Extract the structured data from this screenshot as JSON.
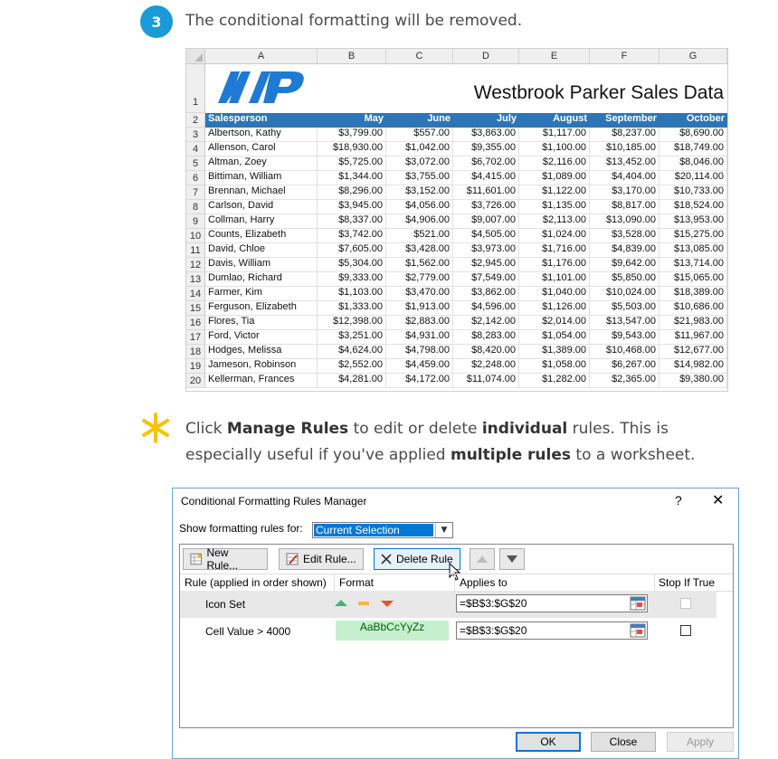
{
  "step": {
    "number": "3",
    "text": "The conditional formatting will be removed."
  },
  "sheet": {
    "columns": [
      "A",
      "B",
      "C",
      "D",
      "E",
      "F",
      "G"
    ],
    "title": "Westbrook Parker Sales Data",
    "logo_text": "WP",
    "header_row_number": "2",
    "title_row_number": "1",
    "headers": [
      "Salesperson",
      "May",
      "June",
      "July",
      "August",
      "September",
      "October"
    ],
    "rows": [
      {
        "n": "3",
        "cells": [
          "Albertson, Kathy",
          "$3,799.00",
          "$557.00",
          "$3,863.00",
          "$1,117.00",
          "$8,237.00",
          "$8,690.00"
        ]
      },
      {
        "n": "4",
        "cells": [
          "Allenson, Carol",
          "$18,930.00",
          "$1,042.00",
          "$9,355.00",
          "$1,100.00",
          "$10,185.00",
          "$18,749.00"
        ]
      },
      {
        "n": "5",
        "cells": [
          "Altman, Zoey",
          "$5,725.00",
          "$3,072.00",
          "$6,702.00",
          "$2,116.00",
          "$13,452.00",
          "$8,046.00"
        ]
      },
      {
        "n": "6",
        "cells": [
          "Bittiman, William",
          "$1,344.00",
          "$3,755.00",
          "$4,415.00",
          "$1,089.00",
          "$4,404.00",
          "$20,114.00"
        ]
      },
      {
        "n": "7",
        "cells": [
          "Brennan, Michael",
          "$8,296.00",
          "$3,152.00",
          "$11,601.00",
          "$1,122.00",
          "$3,170.00",
          "$10,733.00"
        ]
      },
      {
        "n": "8",
        "cells": [
          "Carlson, David",
          "$3,945.00",
          "$4,056.00",
          "$3,726.00",
          "$1,135.00",
          "$8,817.00",
          "$18,524.00"
        ]
      },
      {
        "n": "9",
        "cells": [
          "Collman, Harry",
          "$8,337.00",
          "$4,906.00",
          "$9,007.00",
          "$2,113.00",
          "$13,090.00",
          "$13,953.00"
        ]
      },
      {
        "n": "10",
        "cells": [
          "Counts, Elizabeth",
          "$3,742.00",
          "$521.00",
          "$4,505.00",
          "$1,024.00",
          "$3,528.00",
          "$15,275.00"
        ]
      },
      {
        "n": "11",
        "cells": [
          "David, Chloe",
          "$7,605.00",
          "$3,428.00",
          "$3,973.00",
          "$1,716.00",
          "$4,839.00",
          "$13,085.00"
        ]
      },
      {
        "n": "12",
        "cells": [
          "Davis, William",
          "$5,304.00",
          "$1,562.00",
          "$2,945.00",
          "$1,176.00",
          "$9,642.00",
          "$13,714.00"
        ]
      },
      {
        "n": "13",
        "cells": [
          "Dumlao, Richard",
          "$9,333.00",
          "$2,779.00",
          "$7,549.00",
          "$1,101.00",
          "$5,850.00",
          "$15,065.00"
        ]
      },
      {
        "n": "14",
        "cells": [
          "Farmer, Kim",
          "$1,103.00",
          "$3,470.00",
          "$3,862.00",
          "$1,040.00",
          "$10,024.00",
          "$18,389.00"
        ]
      },
      {
        "n": "15",
        "cells": [
          "Ferguson, Elizabeth",
          "$1,333.00",
          "$1,913.00",
          "$4,596.00",
          "$1,126.00",
          "$5,503.00",
          "$10,686.00"
        ]
      },
      {
        "n": "16",
        "cells": [
          "Flores, Tia",
          "$12,398.00",
          "$2,883.00",
          "$2,142.00",
          "$2,014.00",
          "$13,547.00",
          "$21,983.00"
        ]
      },
      {
        "n": "17",
        "cells": [
          "Ford, Victor",
          "$3,251.00",
          "$4,931.00",
          "$8,283.00",
          "$1,054.00",
          "$9,543.00",
          "$11,967.00"
        ]
      },
      {
        "n": "18",
        "cells": [
          "Hodges, Melissa",
          "$4,624.00",
          "$4,798.00",
          "$8,420.00",
          "$1,389.00",
          "$10,468.00",
          "$12,677.00"
        ]
      },
      {
        "n": "19",
        "cells": [
          "Jameson, Robinson",
          "$2,552.00",
          "$4,459.00",
          "$2,248.00",
          "$1,058.00",
          "$6,267.00",
          "$14,982.00"
        ]
      },
      {
        "n": "20",
        "cells": [
          "Kellerman, Frances",
          "$4,281.00",
          "$4,172.00",
          "$11,074.00",
          "$1,282.00",
          "$2,365.00",
          "$9,380.00"
        ]
      }
    ]
  },
  "tip": {
    "p1": "Click ",
    "b1": "Manage Rules",
    "p2": " to edit or delete ",
    "b2": "individual",
    "p3": " rules. This is especially useful if you've applied ",
    "b3": "multiple rules",
    "p4": " to a worksheet."
  },
  "dialog": {
    "title": "Conditional Formatting Rules Manager",
    "help": "?",
    "close": "✕",
    "show_label": "Show formatting rules for:",
    "show_value": "Current Selection",
    "buttons": {
      "new": "New Rule...",
      "edit": "Edit Rule...",
      "delete": "Delete Rule"
    },
    "columns": {
      "rule": "Rule (applied in order shown)",
      "format": "Format",
      "applies": "Applies to",
      "stop": "Stop If True"
    },
    "rules": [
      {
        "name": "Icon Set",
        "applies_to": "=$B$3:$G$20"
      },
      {
        "name": "Cell Value > 4000",
        "preview": "AaBbCcYyZz",
        "applies_to": "=$B$3:$G$20"
      }
    ],
    "ok": "OK",
    "close_btn": "Close",
    "apply": "Apply"
  }
}
